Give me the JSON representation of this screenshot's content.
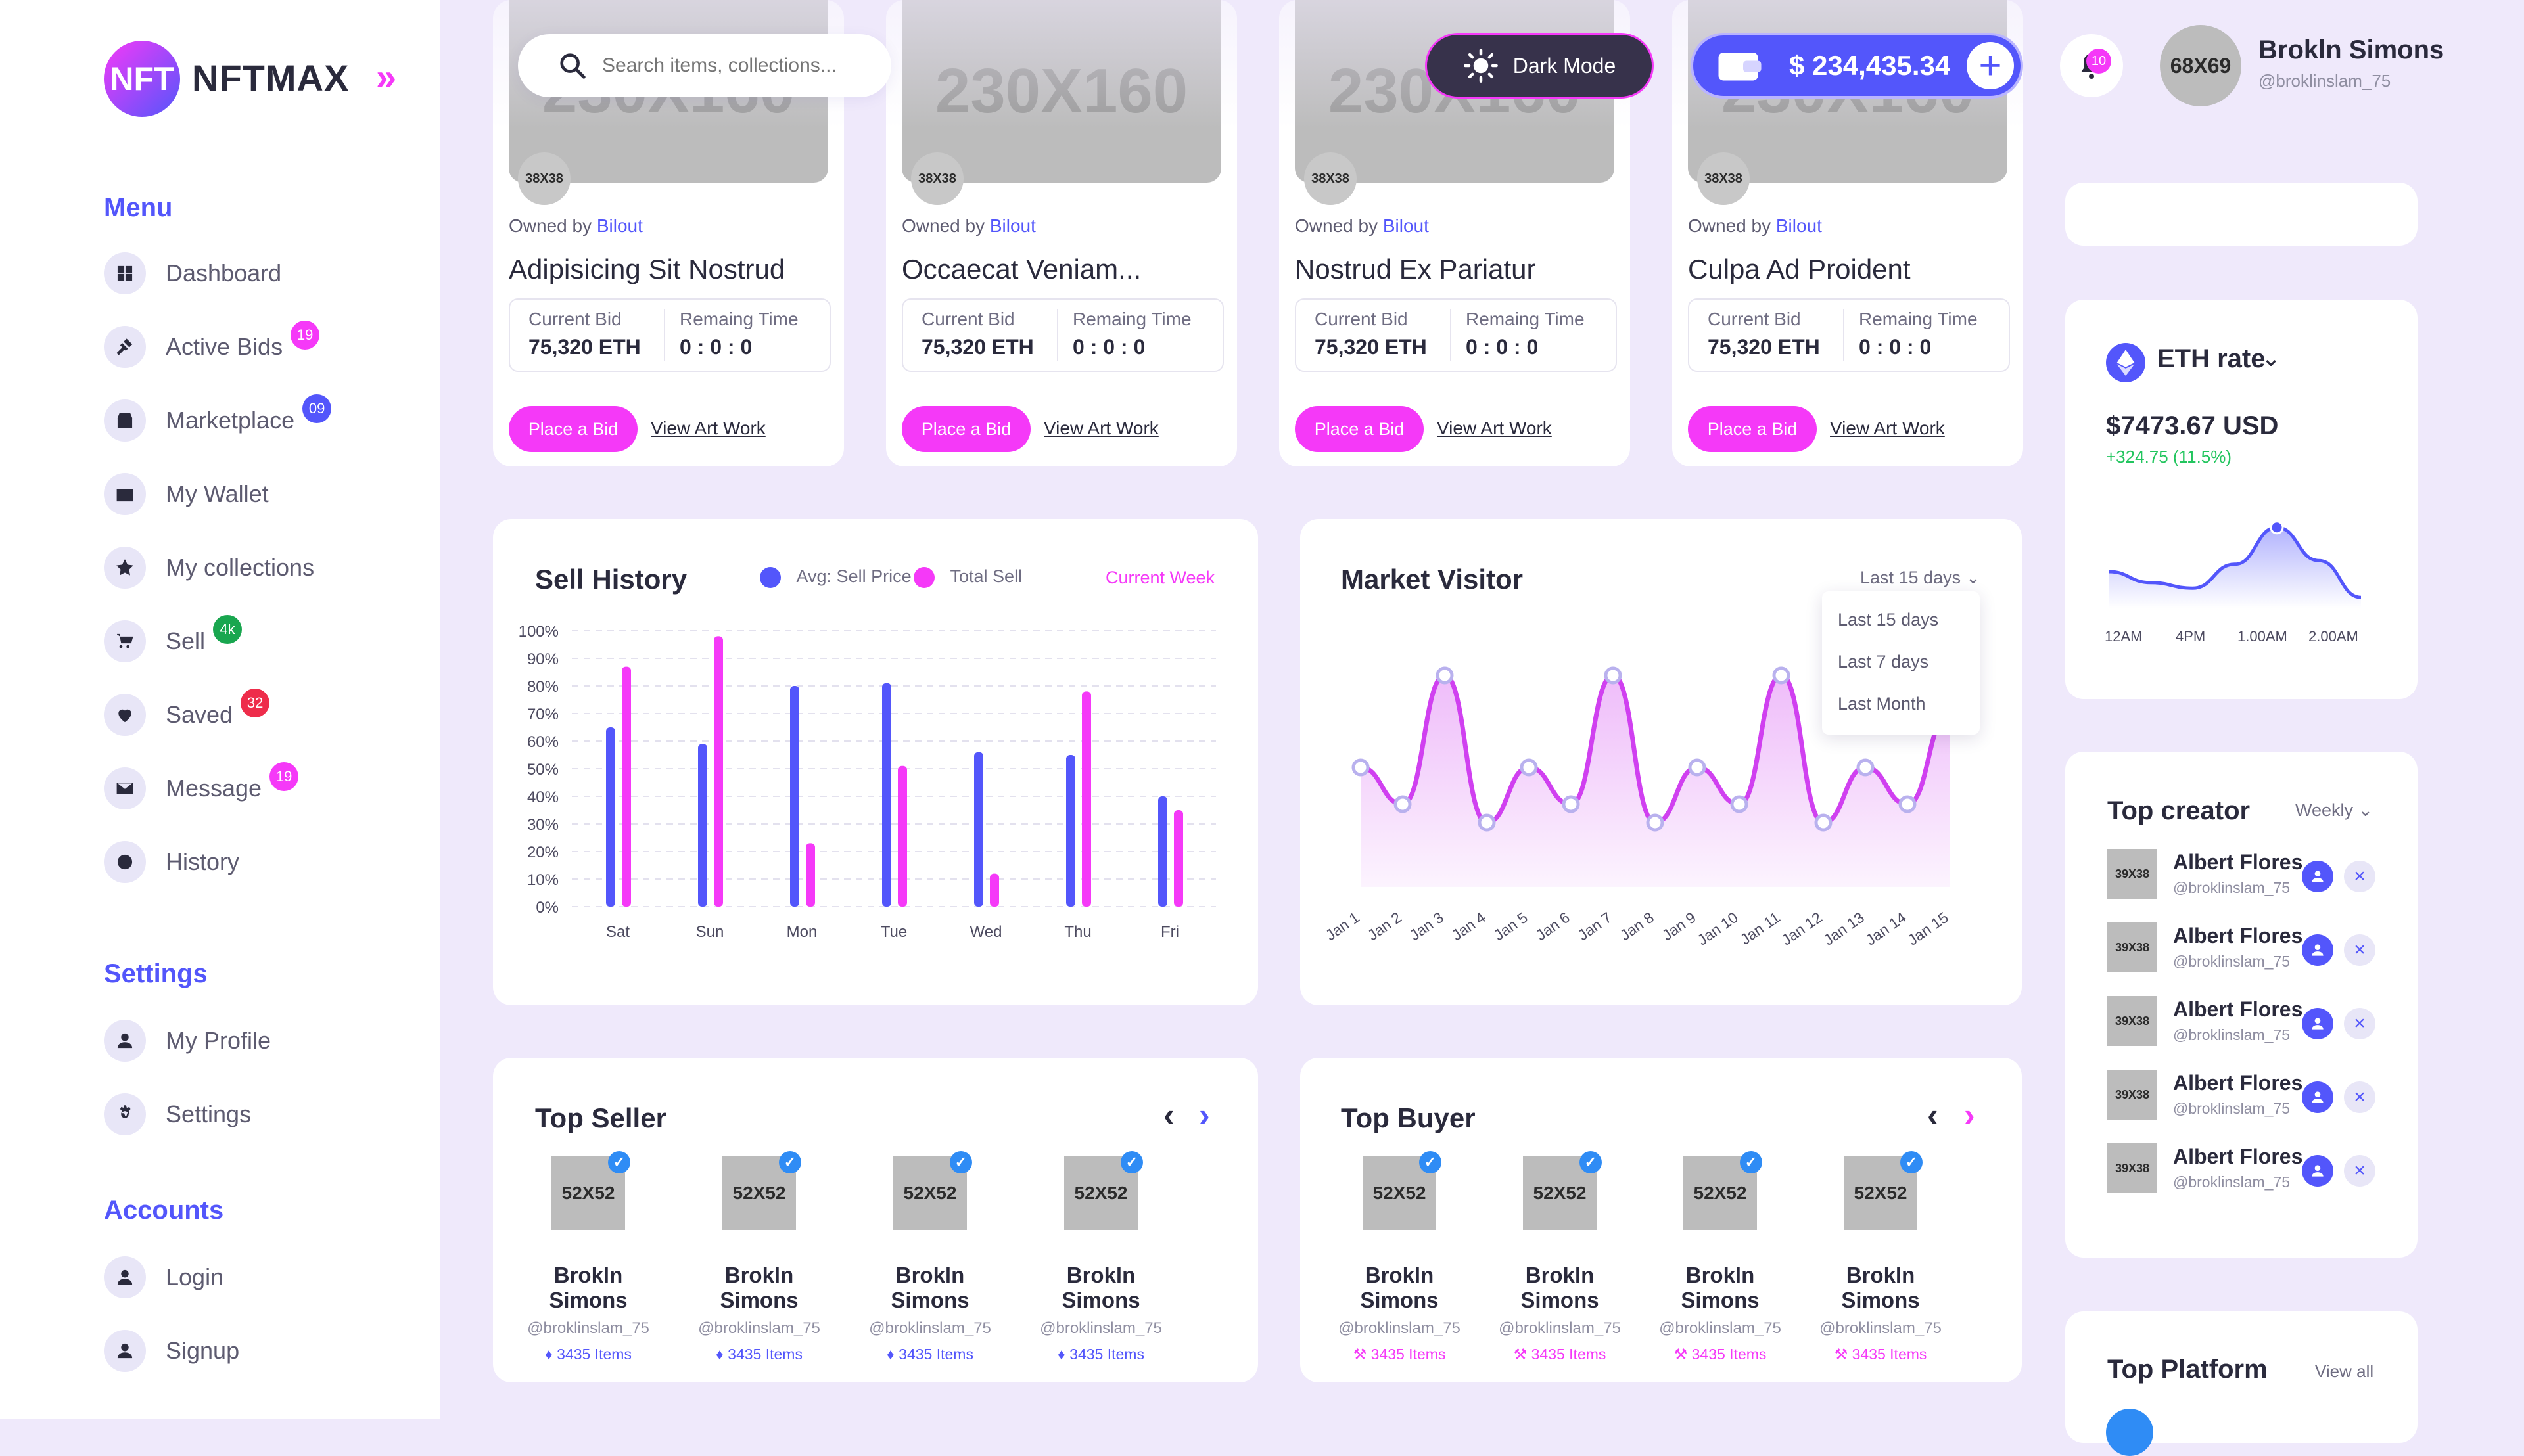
{
  "brand": {
    "name": "NFTMAX",
    "badge": "NFT"
  },
  "colors": {
    "accent": "#5356fb",
    "pink": "#f539f8",
    "green": "#22c55e"
  },
  "sidebar": {
    "menu_heading": "Menu",
    "menu": [
      {
        "label": "Dashboard",
        "icon": "grid-icon"
      },
      {
        "label": "Active Bids",
        "icon": "gavel-icon",
        "badge": "19",
        "badge_color": "#f539f8"
      },
      {
        "label": "Marketplace",
        "icon": "store-icon",
        "badge": "09",
        "badge_color": "#5356fb"
      },
      {
        "label": "My Wallet",
        "icon": "wallet-icon"
      },
      {
        "label": "My collections",
        "icon": "star-icon"
      },
      {
        "label": "Sell",
        "icon": "cart-icon",
        "badge": "4k",
        "badge_color": "#19a64f"
      },
      {
        "label": "Saved",
        "icon": "heart-icon",
        "badge": "32",
        "badge_color": "#ee2d4b"
      },
      {
        "label": "Message",
        "icon": "mail-icon",
        "badge": "19",
        "badge_color": "#f539f8"
      },
      {
        "label": "History",
        "icon": "history-icon"
      }
    ],
    "settings_heading": "Settings",
    "settings": [
      {
        "label": "My Profile",
        "icon": "user-icon"
      },
      {
        "label": "Settings",
        "icon": "gear-icon"
      }
    ],
    "accounts_heading": "Accounts",
    "accounts": [
      {
        "label": "Login",
        "icon": "user-icon"
      },
      {
        "label": "Signup",
        "icon": "user-icon"
      }
    ]
  },
  "topbar": {
    "search_placeholder": "Search items, collections...",
    "dark_mode": "Dark Mode",
    "wallet_amount": "$ 234,435.34",
    "notifications": "10",
    "avatar": "68X69",
    "user_name": "Brokln Simons",
    "user_handle": "@broklinslam_75"
  },
  "nft_cards": [
    {
      "img": "230X160",
      "avatar": "38X38",
      "owned_by": "Owned by",
      "owner": "Bilout",
      "title": "Adipisicing Sit Nostrud",
      "bid_label": "Current Bid",
      "bid": "75,320 ETH",
      "time_label": "Remaing Time",
      "time": "0 : 0 : 0",
      "place_bid": "Place a Bid",
      "view": "View Art Work"
    },
    {
      "img": "230X160",
      "avatar": "38X38",
      "owned_by": "Owned by",
      "owner": "Bilout",
      "title": "Occaecat Veniam...",
      "bid_label": "Current Bid",
      "bid": "75,320 ETH",
      "time_label": "Remaing Time",
      "time": "0 : 0 : 0",
      "place_bid": "Place a Bid",
      "view": "View Art Work"
    },
    {
      "img": "230X160",
      "avatar": "38X38",
      "owned_by": "Owned by",
      "owner": "Bilout",
      "title": "Nostrud Ex Pariatur",
      "bid_label": "Current Bid",
      "bid": "75,320 ETH",
      "time_label": "Remaing Time",
      "time": "0 : 0 : 0",
      "place_bid": "Place a Bid",
      "view": "View Art Work"
    },
    {
      "img": "230X160",
      "avatar": "38X38",
      "owned_by": "Owned by",
      "owner": "Bilout",
      "title": "Culpa Ad Proident",
      "bid_label": "Current Bid",
      "bid": "75,320 ETH",
      "time_label": "Remaing Time",
      "time": "0 : 0 : 0",
      "place_bid": "Place a Bid",
      "view": "View Art Work"
    }
  ],
  "sell_history": {
    "title": "Sell History",
    "legend_avg": "Avg: Sell Price",
    "legend_total": "Total Sell",
    "period": "Current Week"
  },
  "market_visitor": {
    "title": "Market Visitor",
    "period": "Last 15 days",
    "options": [
      "Last 15 days",
      "Last 7 days",
      "Last Month"
    ]
  },
  "eth_rate": {
    "title": "ETH rate",
    "price": "$7473.67 USD",
    "change": "+324.75 (11.5%)"
  },
  "top_creator": {
    "title": "Top creator",
    "period": "Weekly",
    "items": [
      {
        "img": "39X38",
        "name": "Albert Flores",
        "handle": "@broklinslam_75"
      },
      {
        "img": "39X38",
        "name": "Albert Flores",
        "handle": "@broklinslam_75"
      },
      {
        "img": "39X38",
        "name": "Albert Flores",
        "handle": "@broklinslam_75"
      },
      {
        "img": "39X38",
        "name": "Albert Flores",
        "handle": "@broklinslam_75"
      },
      {
        "img": "39X38",
        "name": "Albert Flores",
        "handle": "@broklinslam_75"
      }
    ]
  },
  "top_platform": {
    "title": "Top Platform",
    "view_all": "View all"
  },
  "top_seller": {
    "title": "Top Seller",
    "people": [
      {
        "img": "52X52",
        "name": "Brokln Simons",
        "handle": "@broklinslam_75",
        "items": "3435 Items"
      },
      {
        "img": "52X52",
        "name": "Brokln Simons",
        "handle": "@broklinslam_75",
        "items": "3435 Items"
      },
      {
        "img": "52X52",
        "name": "Brokln Simons",
        "handle": "@broklinslam_75",
        "items": "3435 Items"
      },
      {
        "img": "52X52",
        "name": "Brokln Simons",
        "handle": "@broklinslam_75",
        "items": "3435 Items"
      }
    ]
  },
  "top_buyer": {
    "title": "Top Buyer",
    "people": [
      {
        "img": "52X52",
        "name": "Brokln Simons",
        "handle": "@broklinslam_75",
        "items": "3435 Items"
      },
      {
        "img": "52X52",
        "name": "Brokln Simons",
        "handle": "@broklinslam_75",
        "items": "3435 Items"
      },
      {
        "img": "52X52",
        "name": "Brokln Simons",
        "handle": "@broklinslam_75",
        "items": "3435 Items"
      },
      {
        "img": "52X52",
        "name": "Brokln Simons",
        "handle": "@broklinslam_75",
        "items": "3435 Items"
      }
    ]
  },
  "chart_data": [
    {
      "type": "bar",
      "title": "Sell History",
      "categories": [
        "Sat",
        "Sun",
        "Mon",
        "Tue",
        "Wed",
        "Thu",
        "Fri"
      ],
      "series": [
        {
          "name": "Avg: Sell Price",
          "color": "#5356fb",
          "values": [
            65,
            59,
            80,
            81,
            56,
            55,
            40
          ]
        },
        {
          "name": "Total Sell",
          "color": "#f539f8",
          "values": [
            87,
            98,
            23,
            51,
            12,
            78,
            35
          ]
        }
      ],
      "yticks": [
        "0%",
        "10%",
        "20%",
        "30%",
        "40%",
        "50%",
        "60%",
        "70%",
        "80%",
        "90%",
        "100%"
      ],
      "ylim": [
        0,
        100
      ]
    },
    {
      "type": "area",
      "title": "Market Visitor",
      "categories": [
        "Jan 1",
        "Jan 2",
        "Jan 3",
        "Jan 4",
        "Jan 5",
        "Jan 6",
        "Jan 7",
        "Jan 8",
        "Jan 9",
        "Jan 10",
        "Jan 11",
        "Jan 12",
        "Jan 13",
        "Jan 14",
        "Jan 15"
      ],
      "values": [
        40,
        20,
        90,
        10,
        40,
        20,
        90,
        10,
        40,
        20,
        90,
        10,
        40,
        20,
        70
      ],
      "ylim": [
        0,
        100
      ],
      "color": "#d040f0"
    },
    {
      "type": "area",
      "title": "ETH rate",
      "categories": [
        "12AM",
        "4PM",
        "1.00AM",
        "2.00AM"
      ],
      "values": [
        40,
        28,
        22,
        48,
        88,
        52,
        12
      ],
      "ylim": [
        0,
        100
      ],
      "color": "#5356fb"
    }
  ]
}
